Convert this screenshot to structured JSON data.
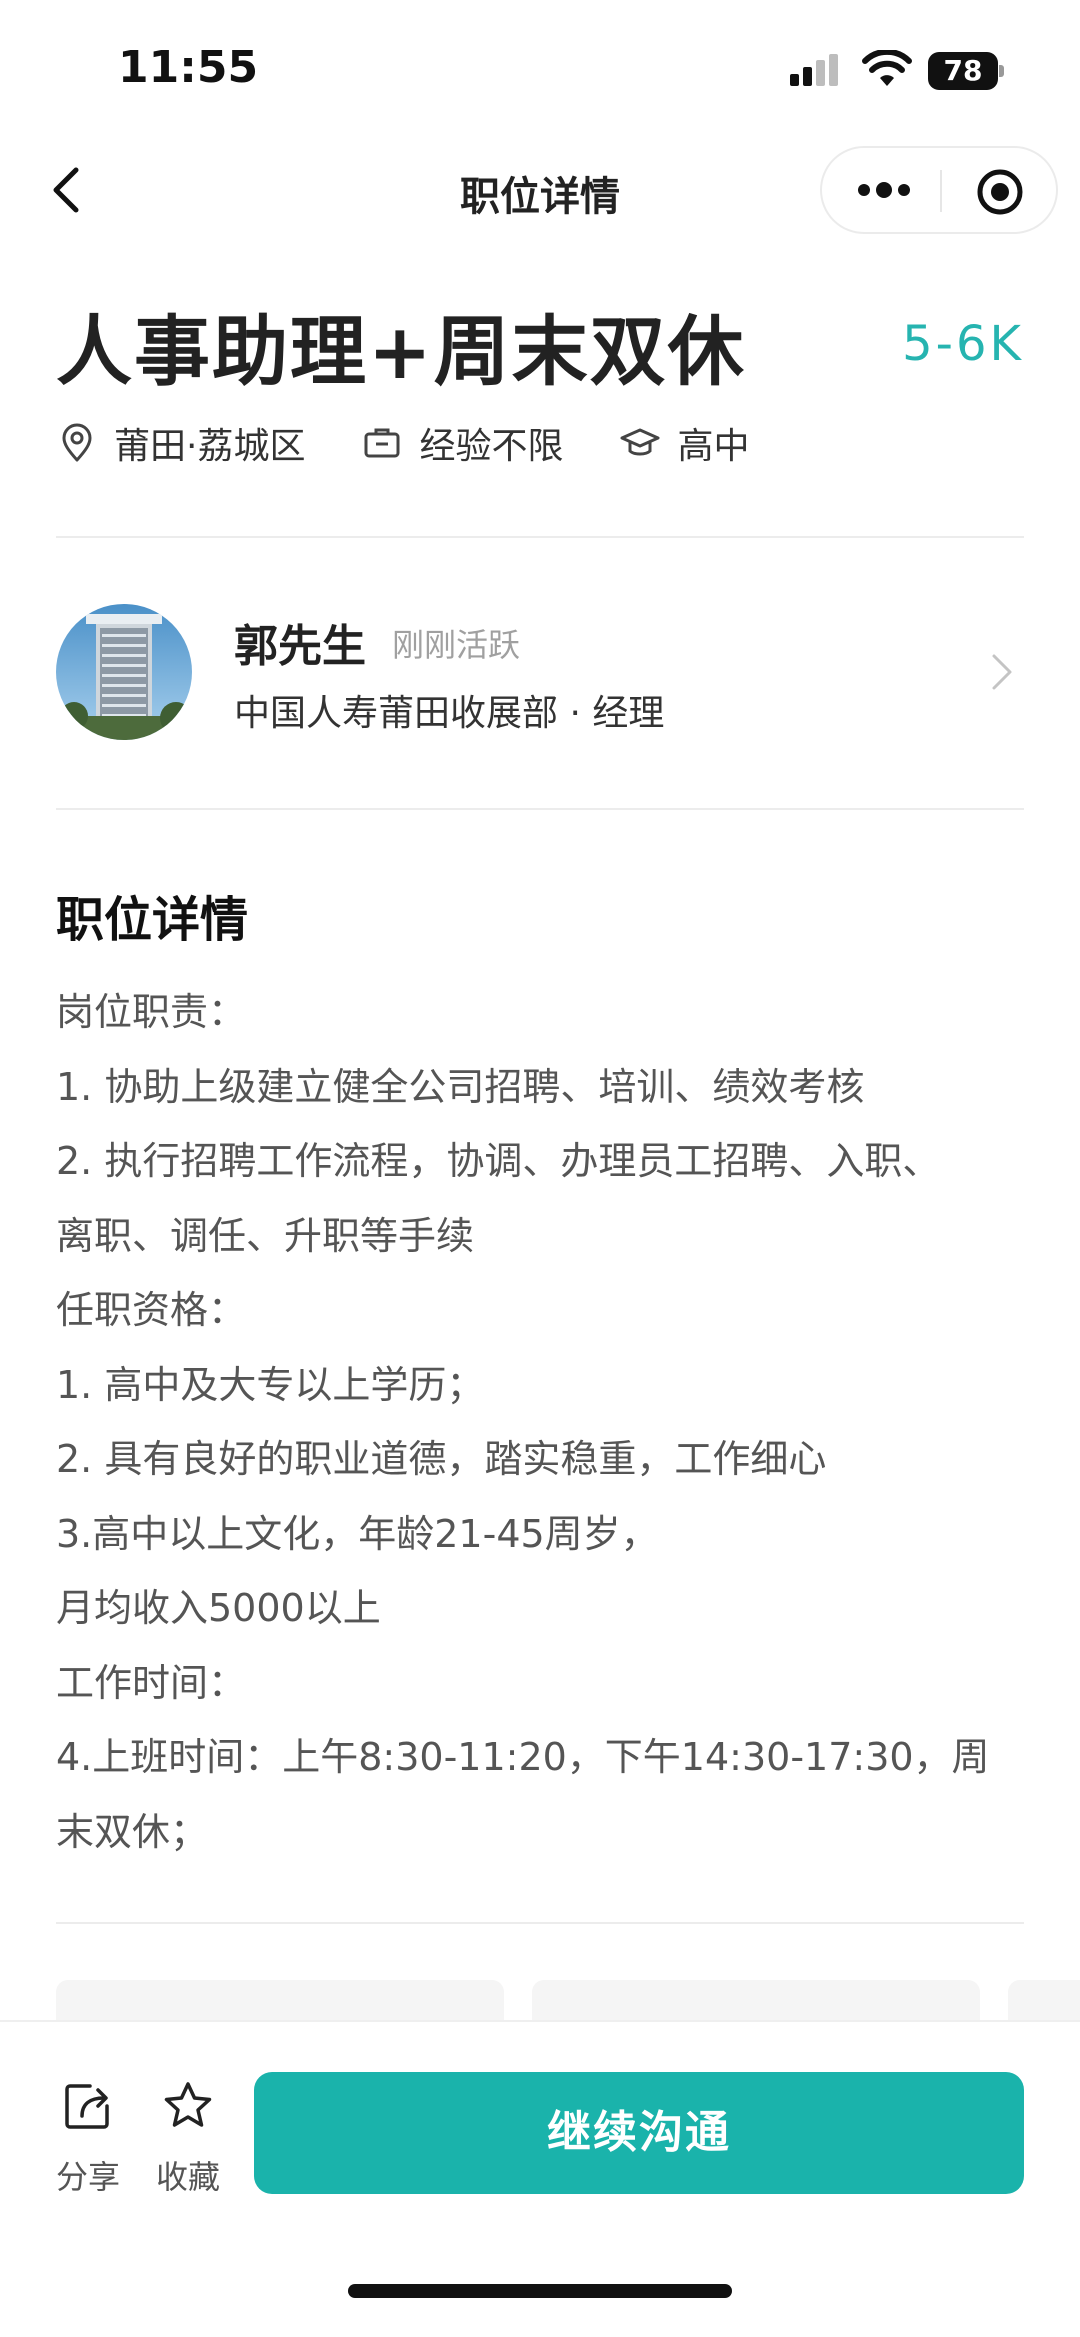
{
  "status_bar": {
    "time": "11:55",
    "battery": "78"
  },
  "nav": {
    "title": "职位详情"
  },
  "job": {
    "title": "人事助理+周末双休",
    "salary": "5-6K",
    "tags": {
      "location": "莆田·荔城区",
      "experience": "经验不限",
      "education": "高中"
    }
  },
  "recruiter": {
    "name": "郭先生",
    "status": "刚刚活跃",
    "company": "中国人寿莆田收展部 · 经理"
  },
  "description": {
    "title": "职位详情",
    "lines": [
      "岗位职责：",
      "1. 协助上级建立健全公司招聘、培训、绩效考核",
      "2. 执行招聘工作流程，协调、办理员工招聘、入职、",
      "离职、调任、升职等手续",
      "任职资格：",
      "1. 高中及大专以上学历；",
      "2. 具有良好的职业道德，踏实稳重，工作细心",
      "3.高中以上文化，年龄21-45周岁，",
      "月均收入5000以上",
      "工作时间：",
      "4.上班时间：上午8:30-11:20，下午14:30-17:30，周",
      "末双休；"
    ]
  },
  "bottom_bar": {
    "share_label": "分享",
    "favorite_label": "收藏",
    "cta_label": "继续沟通"
  },
  "colors": {
    "accent": "#1ab3ab",
    "salary": "#26b4b0"
  }
}
